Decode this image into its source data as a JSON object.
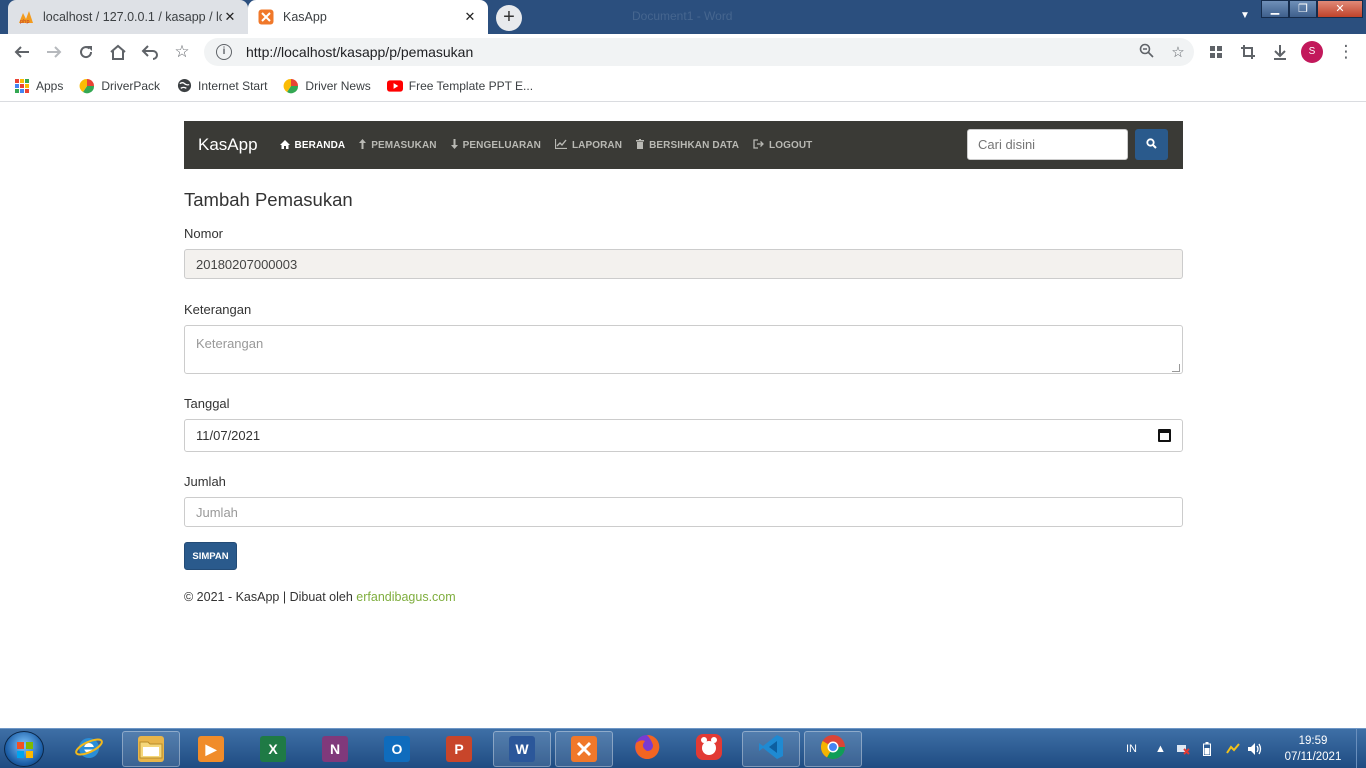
{
  "browser": {
    "tabs": [
      {
        "title": "localhost / 127.0.0.1 / kasapp / lo",
        "active": false
      },
      {
        "title": "KasApp",
        "active": true
      }
    ],
    "window_title_faded": "Document1 - Word",
    "url": "http://localhost/kasapp/p/pemasukan",
    "profile_initial": "S",
    "bookmarks": [
      {
        "label": "Apps",
        "icon": "apps-grid-icon"
      },
      {
        "label": "DriverPack",
        "icon": "driverpack-icon"
      },
      {
        "label": "Internet Start",
        "icon": "globe-icon"
      },
      {
        "label": "Driver News",
        "icon": "driverpack-icon"
      },
      {
        "label": "Free Template PPT E...",
        "icon": "youtube-icon"
      }
    ]
  },
  "navbar": {
    "brand": "KasApp",
    "links": [
      {
        "label": "BERANDA",
        "icon": "home-icon",
        "glyph": "⌂",
        "active": true
      },
      {
        "label": "PEMASUKAN",
        "icon": "arrow-up-icon",
        "glyph": "⤴",
        "active": false
      },
      {
        "label": "PENGELUARAN",
        "icon": "arrow-down-icon",
        "glyph": "⤵",
        "active": false
      },
      {
        "label": "LAPORAN",
        "icon": "chart-icon",
        "glyph": "📈",
        "active": false
      },
      {
        "label": "BERSIHKAN DATA",
        "icon": "trash-icon",
        "glyph": "🗑",
        "active": false
      },
      {
        "label": "LOGOUT",
        "icon": "logout-icon",
        "glyph": "⇥",
        "active": false
      }
    ],
    "search_placeholder": "Cari disini"
  },
  "form": {
    "title": "Tambah Pemasukan",
    "nomor": {
      "label": "Nomor",
      "value": "20180207000003"
    },
    "keterangan": {
      "label": "Keterangan",
      "placeholder": "Keterangan"
    },
    "tanggal": {
      "label": "Tanggal",
      "value": "11/07/2021"
    },
    "jumlah": {
      "label": "Jumlah",
      "placeholder": "Jumlah"
    },
    "submit_label": "SIMPAN"
  },
  "footer": {
    "text": "© 2021 - KasApp | Dibuat oleh ",
    "link": "erfandibagus.com",
    "link_color": "#7fae3e"
  },
  "taskbar": {
    "apps": [
      {
        "name": "file-explorer-icon",
        "letter": "",
        "color": "#e8b54a",
        "pinned": true
      },
      {
        "name": "media-player-icon",
        "letter": "▶",
        "color": "#f08c2a",
        "pinned": false
      },
      {
        "name": "excel-icon",
        "letter": "X",
        "color": "#1f7a45",
        "pinned": false
      },
      {
        "name": "onenote-icon",
        "letter": "N",
        "color": "#80397b",
        "pinned": false
      },
      {
        "name": "outlook-icon",
        "letter": "O",
        "color": "#0f6cbd",
        "pinned": false
      },
      {
        "name": "powerpoint-icon",
        "letter": "P",
        "color": "#c8452a",
        "pinned": false
      },
      {
        "name": "word-icon",
        "letter": "W",
        "color": "#2b579a",
        "pinned": true
      },
      {
        "name": "xampp-icon",
        "letter": "⊠",
        "color": "#f0782a",
        "pinned": true
      },
      {
        "name": "firefox-icon",
        "letter": "",
        "color": "#e8601c",
        "pinned": false
      },
      {
        "name": "nox-player-icon",
        "letter": "",
        "color": "#e23a34",
        "pinned": false
      },
      {
        "name": "vscode-icon",
        "letter": "⟩",
        "color": "#1f8ad2",
        "pinned": true
      },
      {
        "name": "chrome-icon",
        "letter": "",
        "color": "#3c8f3c",
        "pinned": true
      }
    ],
    "language": "IN",
    "time": "19:59",
    "date": "07/11/2021"
  },
  "colors": {
    "navbar_bg": "#3a3a36",
    "primary": "#2a5a8c",
    "readonly_bg": "#f3f1ee",
    "taskbar": "#2a5a8f"
  }
}
